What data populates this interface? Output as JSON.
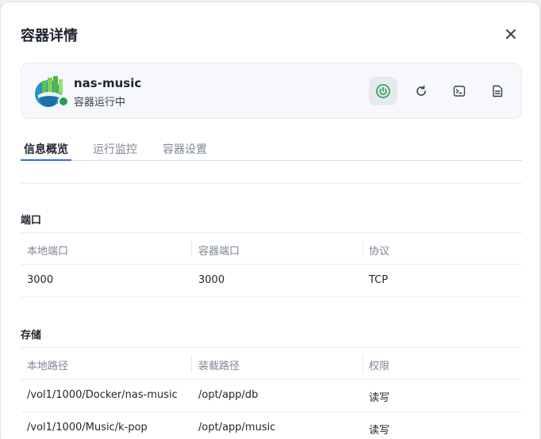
{
  "dialog": {
    "title": "容器详情"
  },
  "container": {
    "name": "nas-music",
    "status": "容器运行中",
    "status_color": "#22a14a"
  },
  "actions": [
    {
      "name": "power-icon",
      "active": true
    },
    {
      "name": "restart-icon",
      "active": false
    },
    {
      "name": "terminal-icon",
      "active": false
    },
    {
      "name": "log-icon",
      "active": false
    }
  ],
  "tabs": [
    {
      "label": "信息概览",
      "active": true
    },
    {
      "label": "运行监控",
      "active": false
    },
    {
      "label": "容器设置",
      "active": false
    }
  ],
  "ports": {
    "title": "端口",
    "headers": [
      "本地端口",
      "容器端口",
      "协议"
    ],
    "rows": [
      [
        "3000",
        "3000",
        "TCP"
      ]
    ]
  },
  "storage": {
    "title": "存储",
    "headers": [
      "本地路径",
      "装载路径",
      "权限"
    ],
    "rows": [
      [
        "/vol1/1000/Docker/nas-music",
        "/opt/app/db",
        "读写"
      ],
      [
        "/vol1/1000/Music/k-pop",
        "/opt/app/music",
        "读写"
      ]
    ]
  },
  "colors": {
    "accent": "#2f6fe0",
    "power_green": "#22a14a"
  }
}
